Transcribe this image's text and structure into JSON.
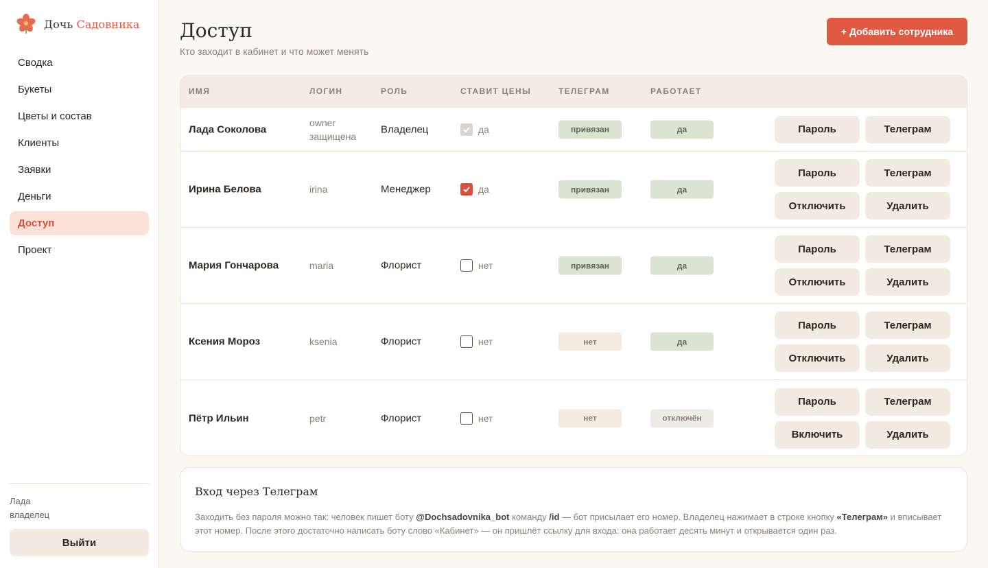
{
  "brand": {
    "name_part1": "Дочь",
    "name_part2": "Садовника",
    "colors": {
      "accent": "#e05a43",
      "active_bg": "#fbe1d8"
    }
  },
  "nav": {
    "items": [
      {
        "label": "Сводка",
        "active": false
      },
      {
        "label": "Букеты",
        "active": false
      },
      {
        "label": "Цветы и состав",
        "active": false
      },
      {
        "label": "Клиенты",
        "active": false
      },
      {
        "label": "Заявки",
        "active": false
      },
      {
        "label": "Деньги",
        "active": false
      },
      {
        "label": "Доступ",
        "active": true
      },
      {
        "label": "Проект",
        "active": false
      }
    ]
  },
  "user": {
    "name": "Лада",
    "role": "владелец",
    "logout_label": "Выйти"
  },
  "header": {
    "title": "Доступ",
    "subtitle": "Кто заходит в кабинет и что может менять",
    "add_button": "+ Добавить сотрудника"
  },
  "table": {
    "columns": [
      "ИМЯ",
      "ЛОГИН",
      "РОЛЬ",
      "СТАВИТ ЦЕНЫ",
      "ТЕЛЕГРАМ",
      "РАБОТАЕТ"
    ],
    "rows": [
      {
        "name": "Лада Соколова",
        "login": "owner",
        "login_note": "защищена",
        "role": "Владелец",
        "price_checked": true,
        "price_disabled": true,
        "price_label": "да",
        "telegram": "привязан",
        "telegram_status": "linked",
        "works": "да",
        "works_status": "active",
        "actions": [
          "Пароль",
          "Телеграм"
        ]
      },
      {
        "name": "Ирина Белова",
        "login": "irina",
        "login_note": "",
        "role": "Менеджер",
        "price_checked": true,
        "price_disabled": false,
        "price_label": "да",
        "telegram": "привязан",
        "telegram_status": "linked",
        "works": "да",
        "works_status": "active",
        "actions": [
          "Пароль",
          "Телеграм",
          "Отключить",
          "Удалить"
        ]
      },
      {
        "name": "Мария Гончарова",
        "login": "maria",
        "login_note": "",
        "role": "Флорист",
        "price_checked": false,
        "price_disabled": false,
        "price_label": "нет",
        "telegram": "привязан",
        "telegram_status": "linked",
        "works": "да",
        "works_status": "active",
        "actions": [
          "Пароль",
          "Телеграм",
          "Отключить",
          "Удалить"
        ]
      },
      {
        "name": "Ксения Мороз",
        "login": "ksenia",
        "login_note": "",
        "role": "Флорист",
        "price_checked": false,
        "price_disabled": false,
        "price_label": "нет",
        "telegram": "нет",
        "telegram_status": "none",
        "works": "да",
        "works_status": "active",
        "actions": [
          "Пароль",
          "Телеграм",
          "Отключить",
          "Удалить"
        ]
      },
      {
        "name": "Пётр Ильин",
        "login": "petr",
        "login_note": "",
        "role": "Флорист",
        "price_checked": false,
        "price_disabled": false,
        "price_label": "нет",
        "telegram": "нет",
        "telegram_status": "none",
        "works": "отключён",
        "works_status": "disabled",
        "actions": [
          "Пароль",
          "Телеграм",
          "Включить",
          "Удалить"
        ]
      }
    ]
  },
  "info": {
    "title": "Вход через Телеграм",
    "t1": "Заходить без пароля можно так: человек пишет боту ",
    "b1": "@Dochsadovnika_bot",
    "t2": " команду ",
    "b2": "/id",
    "t3": " — бот присылает его номер. Владелец нажимает в строке кнопку ",
    "b3": "«Телеграм»",
    "t4": " и вписывает этот номер. После этого достаточно написать боту слово «Кабинет» — он пришлёт ссылку для входа: она работает десять минут и открывается один раз."
  }
}
